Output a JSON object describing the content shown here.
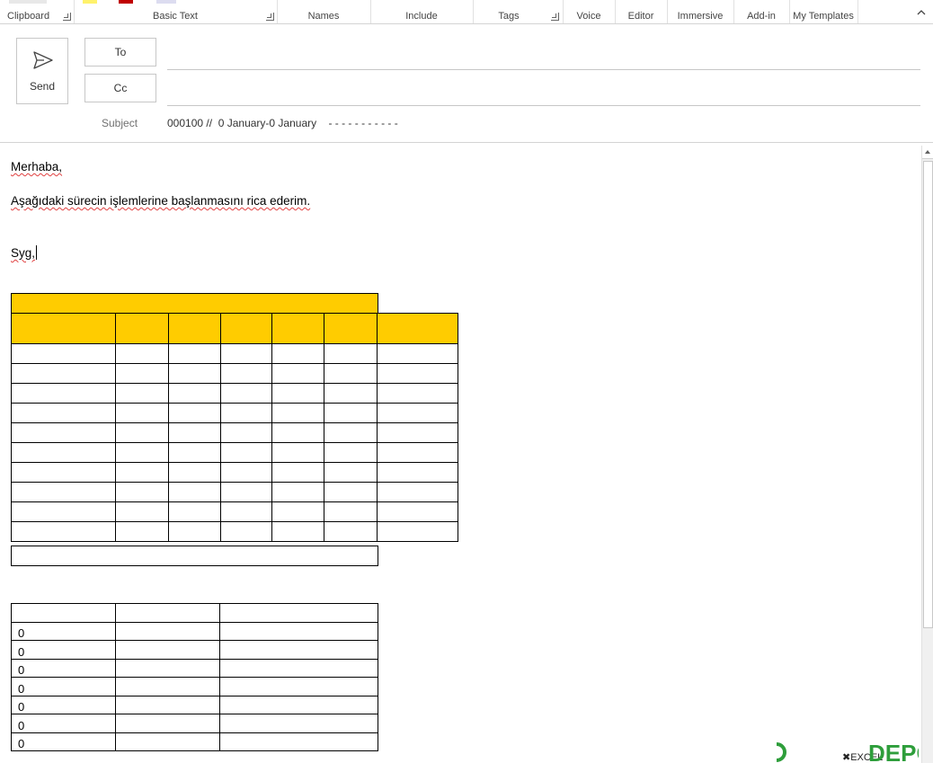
{
  "ribbon": {
    "groups": [
      {
        "label": "Clipboard"
      },
      {
        "label": "Basic Text"
      },
      {
        "label": "Names"
      },
      {
        "label": "Include"
      },
      {
        "label": "Tags"
      },
      {
        "label": "Voice"
      },
      {
        "label": "Editor"
      },
      {
        "label": "Immersive"
      },
      {
        "label": "Add-in"
      },
      {
        "label": "My Templates"
      }
    ]
  },
  "compose": {
    "send_label": "Send",
    "to_label": "To",
    "cc_label": "Cc",
    "to_value": "",
    "cc_value": "",
    "subject_label": "Subject",
    "subject_value": "000100 //  0 January-0 January    - - - - - - - - - - -"
  },
  "body": {
    "greeting": "Merhaba,",
    "request_line": "Aşağıdaki sürecin işlemlerine başlanmasını rica ederim.",
    "signoff": "Syg,"
  },
  "table1": {
    "title_row": "",
    "rows": 10
  },
  "table2": {
    "header": [
      "",
      "",
      ""
    ],
    "rows": [
      [
        "0",
        "",
        ""
      ],
      [
        "0",
        "",
        ""
      ],
      [
        "0",
        "",
        ""
      ],
      [
        "0",
        "",
        ""
      ],
      [
        "0",
        "",
        ""
      ],
      [
        "0",
        "",
        ""
      ],
      [
        "0",
        "",
        ""
      ]
    ]
  },
  "colors": {
    "table_header": "#ffcc00",
    "accent_green": "#2e9e3b"
  },
  "watermark": {
    "text": "DEPO"
  }
}
